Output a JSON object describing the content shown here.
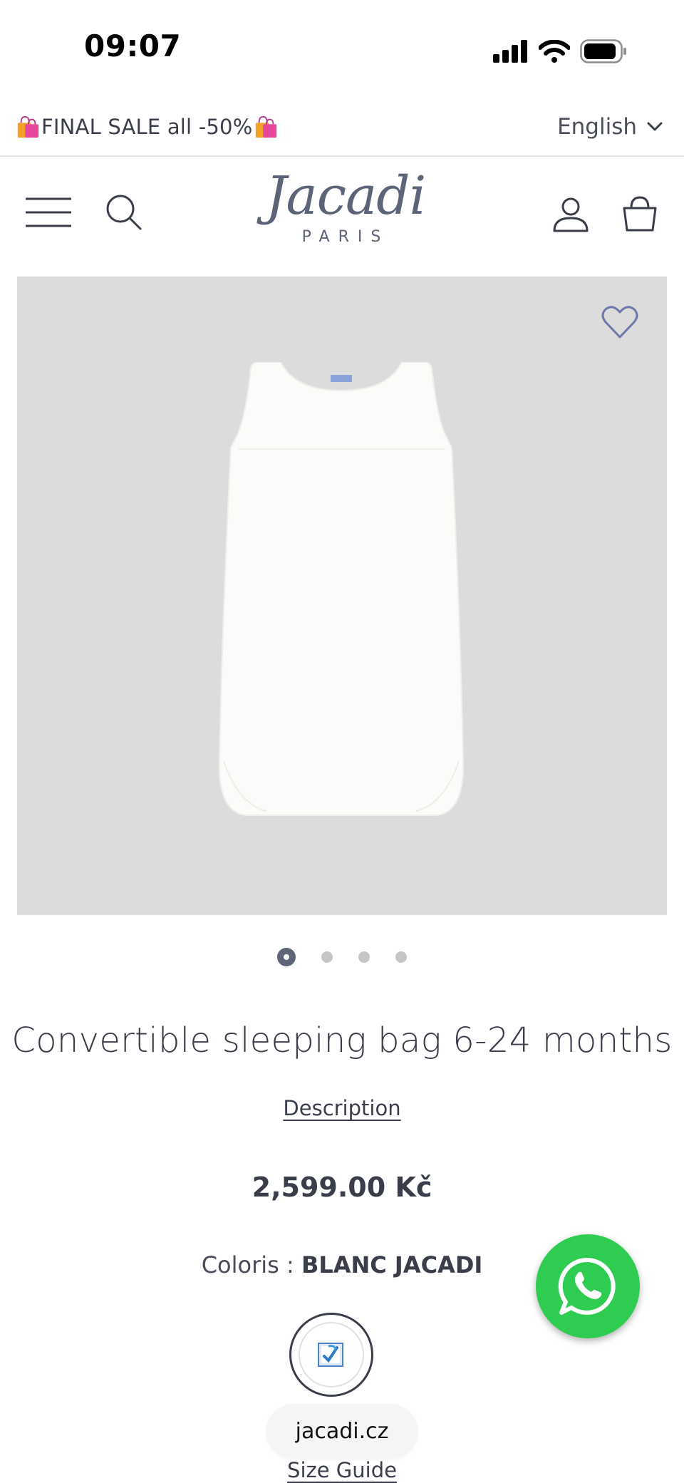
{
  "status_bar": {
    "time": "09:07"
  },
  "promo": {
    "text": "FINAL SALE all -50%",
    "language": "English"
  },
  "header": {
    "logo_word": "Jacadi",
    "logo_sub": "PARIS"
  },
  "carousel": {
    "total": 4,
    "active": 1
  },
  "product": {
    "title": "Convertible sleeping bag 6-24 months",
    "description_link": "Description",
    "price": "2,599.00 Kč",
    "color_label": "Coloris :",
    "color_value": "BLANC JACADI",
    "size_guide_link": "Size Guide"
  },
  "browser": {
    "url": "jacadi.cz"
  },
  "colors": {
    "accent": "#5e6577",
    "whatsapp": "#2ecc50",
    "image_bg": "#dcdcdc"
  }
}
